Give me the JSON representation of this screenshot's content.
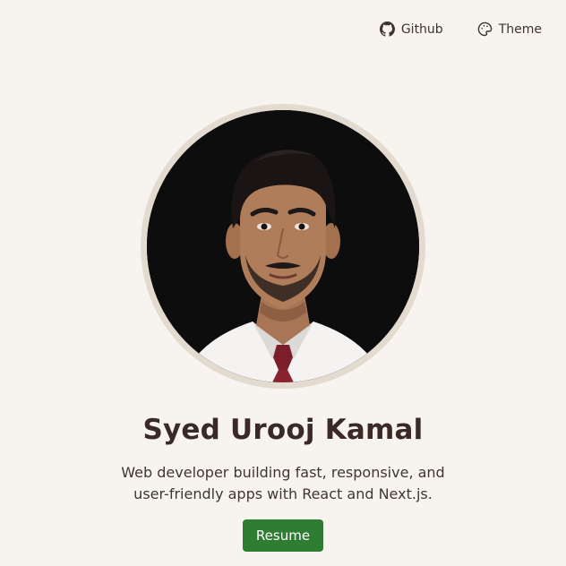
{
  "header": {
    "github_label": "Github",
    "theme_label": "Theme"
  },
  "profile": {
    "name": "Syed Urooj Kamal",
    "bio_line_1": "Web developer building fast, responsive, and",
    "bio_line_2": "user-friendly apps with React and Next.js.",
    "resume_label": "Resume"
  },
  "colors": {
    "background": "#f7f4ef",
    "avatar_ring": "#e3dbd0",
    "resume_button": "#2e7d32",
    "text": "#3a2a25"
  },
  "icons": {
    "github": "github-icon",
    "theme": "palette-icon"
  }
}
